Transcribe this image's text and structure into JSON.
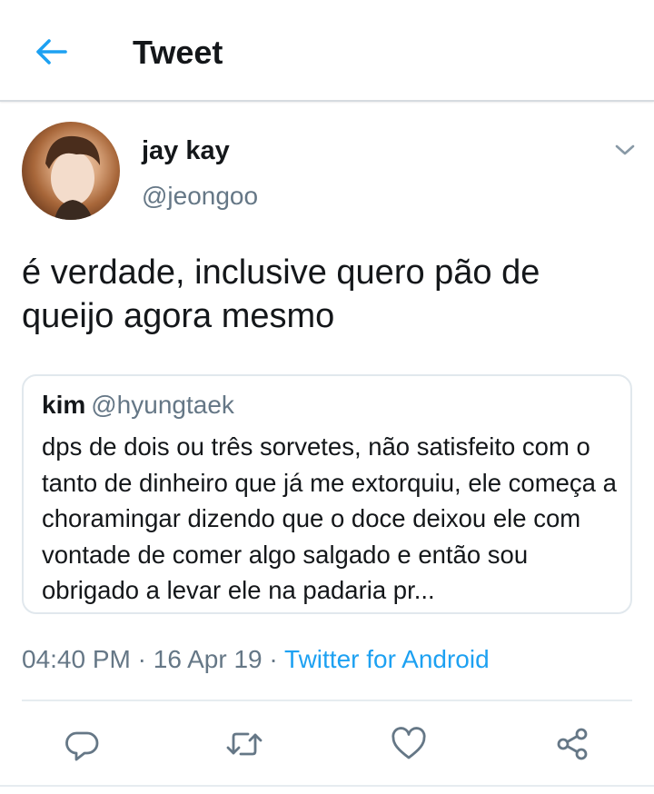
{
  "header": {
    "title": "Tweet",
    "back_icon": "arrow-left-icon"
  },
  "author": {
    "display_name": "jay kay",
    "handle": "@jeongoo",
    "menu_icon": "chevron-down-icon"
  },
  "tweet": {
    "text": "é verdade, inclusive quero pão de queijo agora mesmo"
  },
  "quote": {
    "name": "kim",
    "handle": "@hyungtaek",
    "text": "dps de dois ou três sorvetes, não satisfeito com o tanto de dinheiro que já me extorquiu, ele começa a choramingar dizendo que o doce deixou ele com vontade de comer algo salgado e então sou obrigado a levar ele na padaria pr..."
  },
  "meta": {
    "time": "04:40 PM",
    "separator": "·",
    "date": "16 Apr 19",
    "source": "Twitter for Android"
  },
  "actions": [
    {
      "icon": "reply-icon"
    },
    {
      "icon": "retweet-icon"
    },
    {
      "icon": "like-heart-icon"
    },
    {
      "icon": "share-icon"
    }
  ],
  "colors": {
    "accent": "#1da1f2",
    "text": "#14171a",
    "secondary": "#657786",
    "border": "#e1e8ed"
  }
}
